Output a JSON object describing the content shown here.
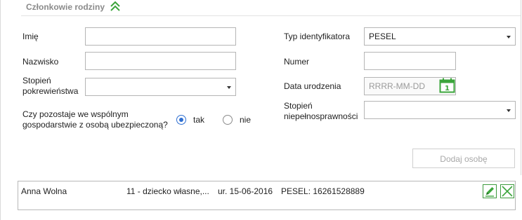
{
  "section": {
    "title": "Członkowie rodziny",
    "collapse_icon": "double-chevron-up-icon",
    "accent_color": "#3ba53b"
  },
  "form": {
    "imie_label": "Imię",
    "imie_value": "",
    "nazwisko_label": "Nazwisko",
    "nazwisko_value": "",
    "stopien_pokrewienstwa_label_1": "Stopień",
    "stopien_pokrewienstwa_label_2": "pokrewieństwa",
    "stopien_pokrewienstwa_value": "",
    "gospodarstwo_label_1": "Czy pozostaje we wspólnym",
    "gospodarstwo_label_2": "gospodarstwie z osobą ubezpieczoną?",
    "radio_tak": "tak",
    "radio_nie": "nie",
    "radio_selected": "tak",
    "typ_identyfikatora_label": "Typ identyfikatora",
    "typ_identyfikatora_value": "PESEL",
    "numer_label": "Numer",
    "numer_value": "",
    "data_urodzenia_label": "Data urodzenia",
    "data_urodzenia_placeholder": "RRRR-MM-DD",
    "calendar_icon": "calendar-icon",
    "calendar_icon_text": "1",
    "stopien_niepelnosprawnosci_label_1": "Stopień",
    "stopien_niepelnosprawnosci_label_2": "niepełnosprawności",
    "stopien_niepelnosprawnosci_value": "",
    "add_button": "Dodaj osobę"
  },
  "members": [
    {
      "name": "Anna Wolna",
      "relation": "11 - dziecko własne,...",
      "birth": "ur. 15-06-2016",
      "id": "PESEL: 16261528889",
      "edit_icon": "pencil-icon",
      "delete_icon": "close-icon"
    }
  ]
}
